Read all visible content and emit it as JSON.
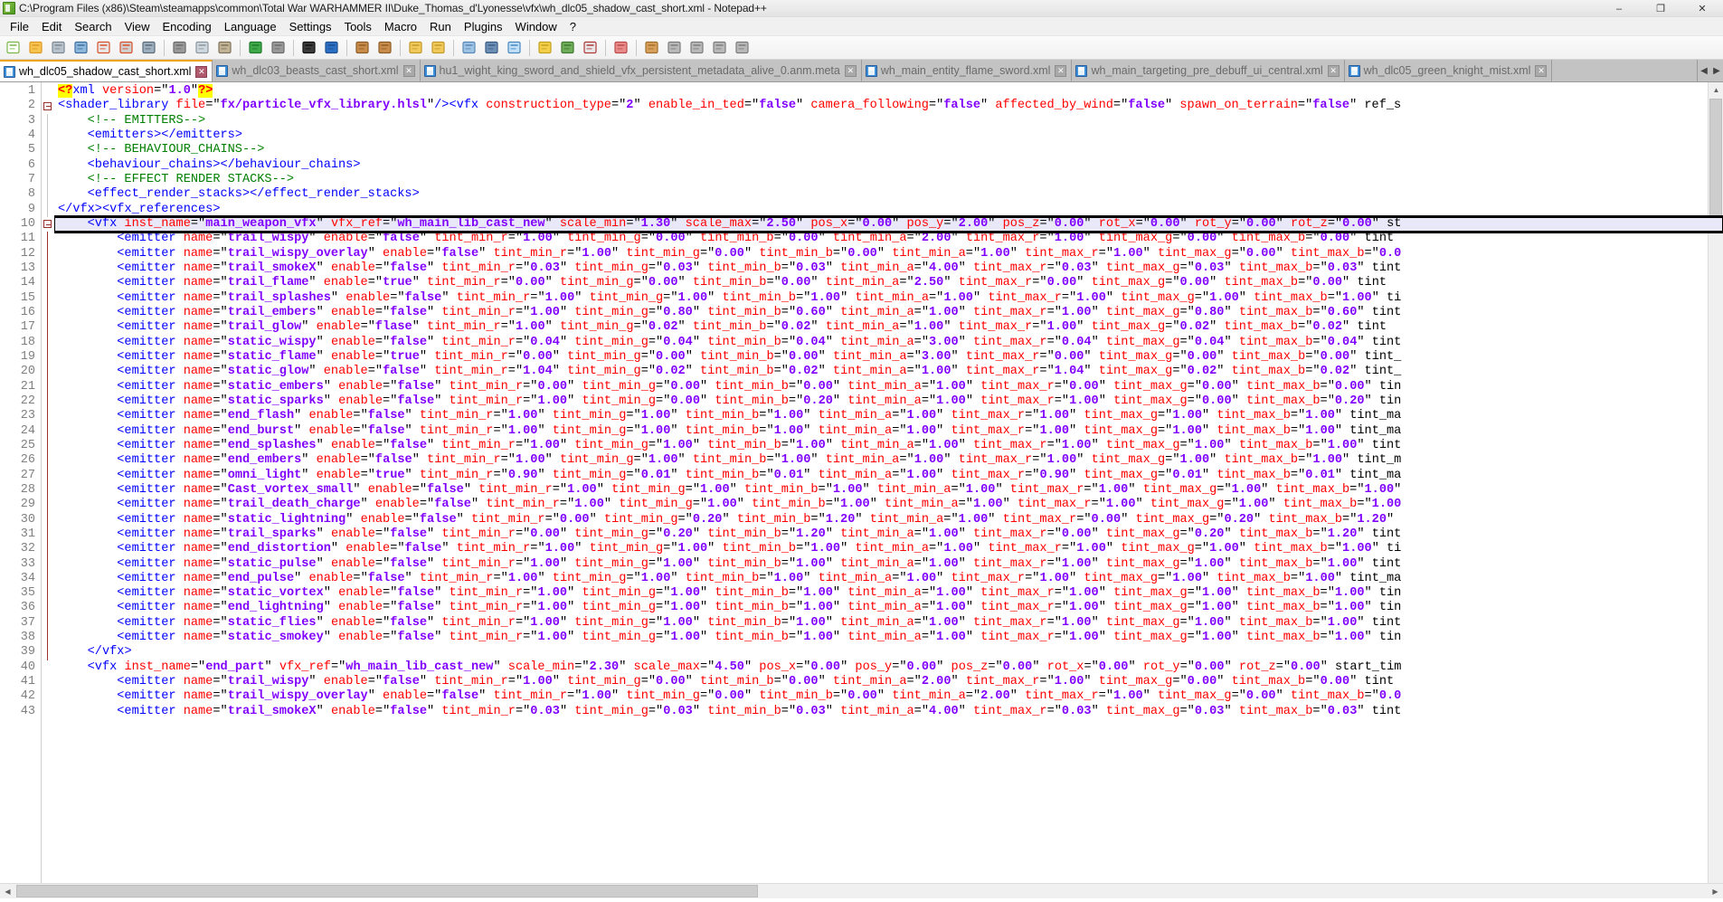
{
  "window": {
    "title": "C:\\Program Files (x86)\\Steam\\steamapps\\common\\Total War WARHAMMER II\\Duke_Thomas_d'Lyonesse\\vfx\\wh_dlc05_shadow_cast_short.xml - Notepad++",
    "icon": "notepadpp-icon",
    "minimize": "–",
    "maximize": "❐",
    "close": "✕"
  },
  "menu": {
    "items": [
      "File",
      "Edit",
      "Search",
      "View",
      "Encoding",
      "Language",
      "Settings",
      "Tools",
      "Macro",
      "Run",
      "Plugins",
      "Window",
      "?"
    ]
  },
  "toolbar": {
    "buttons": [
      "new-file-icon",
      "open-folder-icon",
      "save-icon",
      "save-all-icon",
      "close-file-icon",
      "close-all-icon",
      "print-icon",
      "cut-icon",
      "copy-icon",
      "paste-icon",
      "undo-icon",
      "redo-icon",
      "find-icon",
      "replace-icon",
      "zoom-in-icon",
      "zoom-out-icon",
      "sync-vertical-icon",
      "sync-horizontal-icon",
      "word-wrap-icon",
      "all-chars-icon",
      "indent-guide-icon",
      "ui-userdefined-icon",
      "doc-map-icon",
      "function-list-icon",
      "folder-workspace-icon",
      "macro-record-icon",
      "macro-stop-icon",
      "macro-play-icon",
      "macro-playmulti-icon",
      "macro-save-icon"
    ]
  },
  "tabs": [
    {
      "label": "wh_dlc05_shadow_cast_short.xml",
      "active": true,
      "close": "✕"
    },
    {
      "label": "wh_dlc03_beasts_cast_short.xml",
      "active": false,
      "close": "✕"
    },
    {
      "label": "hu1_wight_king_sword_and_shield_vfx_persistent_metadata_alive_0.anm.meta",
      "active": false,
      "close": "✕"
    },
    {
      "label": "wh_main_entity_flame_sword.xml",
      "active": false,
      "close": "✕"
    },
    {
      "label": "wh_main_targeting_pre_debuff_ui_central.xml",
      "active": false,
      "close": "✕"
    },
    {
      "label": "wh_dlc05_green_knight_mist.xml",
      "active": false,
      "close": "✕"
    }
  ],
  "tab_nav": {
    "left": "◀",
    "right": "▶"
  },
  "editor": {
    "first_line": 1,
    "highlighted_line": 10,
    "line_numbers": [
      1,
      2,
      3,
      4,
      5,
      6,
      7,
      8,
      9,
      10,
      11,
      12,
      13,
      14,
      15,
      16,
      17,
      18,
      19,
      20,
      21,
      22,
      23,
      24,
      25,
      26,
      27,
      28,
      29,
      30,
      31,
      32,
      33,
      34,
      35,
      36,
      37,
      38,
      39,
      40,
      41,
      42,
      43
    ],
    "lines": [
      {
        "n": 1,
        "indent": 0,
        "type": "pi",
        "text": "<?xml version=\"1.0\"?>"
      },
      {
        "n": 2,
        "indent": 0,
        "type": "code",
        "text": "<shader_library file=\"fx/particle_vfx_library.hlsl\"/><vfx construction_type=\"2\" enable_in_ted=\"false\" camera_following=\"false\" affected_by_wind=\"false\" spawn_on_terrain=\"false\" ref_s"
      },
      {
        "n": 3,
        "indent": 2,
        "type": "comment",
        "text": "<!-- EMITTERS-->"
      },
      {
        "n": 4,
        "indent": 2,
        "type": "code",
        "text": "<emitters></emitters>"
      },
      {
        "n": 5,
        "indent": 2,
        "type": "comment",
        "text": "<!-- BEHAVIOUR_CHAINS-->"
      },
      {
        "n": 6,
        "indent": 2,
        "type": "code",
        "text": "<behaviour_chains></behaviour_chains>"
      },
      {
        "n": 7,
        "indent": 2,
        "type": "comment",
        "text": "<!-- EFFECT RENDER STACKS-->"
      },
      {
        "n": 8,
        "indent": 2,
        "type": "code",
        "text": "<effect_render_stacks></effect_render_stacks>"
      },
      {
        "n": 9,
        "indent": 0,
        "type": "code",
        "text": "</vfx><vfx_references>"
      },
      {
        "n": 10,
        "indent": 2,
        "type": "code",
        "text": "<vfx inst_name=\"main_weapon_vfx\" vfx_ref=\"wh_main_lib_cast_new\" scale_min=\"1.30\" scale_max=\"2.50\" pos_x=\"0.00\" pos_y=\"2.00\" pos_z=\"0.00\" rot_x=\"0.00\" rot_y=\"0.00\" rot_z=\"0.00\" st"
      },
      {
        "n": 11,
        "indent": 4,
        "type": "code",
        "text": "<emitter name=\"trail_wispy\" enable=\"false\" tint_min_r=\"1.00\" tint_min_g=\"0.00\" tint_min_b=\"0.00\" tint_min_a=\"2.00\" tint_max_r=\"1.00\" tint_max_g=\"0.00\" tint_max_b=\"0.00\" tint"
      },
      {
        "n": 12,
        "indent": 4,
        "type": "code",
        "text": "<emitter name=\"trail_wispy_overlay\" enable=\"false\" tint_min_r=\"1.00\" tint_min_g=\"0.00\" tint_min_b=\"0.00\" tint_min_a=\"1.00\" tint_max_r=\"1.00\" tint_max_g=\"0.00\" tint_max_b=\"0.0"
      },
      {
        "n": 13,
        "indent": 4,
        "type": "code",
        "text": "<emitter name=\"trail_smokeX\" enable=\"false\" tint_min_r=\"0.03\" tint_min_g=\"0.03\" tint_min_b=\"0.03\" tint_min_a=\"4.00\" tint_max_r=\"0.03\" tint_max_g=\"0.03\" tint_max_b=\"0.03\" tint"
      },
      {
        "n": 14,
        "indent": 4,
        "type": "code",
        "text": "<emitter name=\"trail_flame\" enable=\"true\" tint_min_r=\"0.00\" tint_min_g=\"0.00\" tint_min_b=\"0.00\" tint_min_a=\"2.50\" tint_max_r=\"0.00\" tint_max_g=\"0.00\" tint_max_b=\"0.00\" tint"
      },
      {
        "n": 15,
        "indent": 4,
        "type": "code",
        "text": "<emitter name=\"trail_splashes\" enable=\"false\" tint_min_r=\"1.00\" tint_min_g=\"1.00\" tint_min_b=\"1.00\" tint_min_a=\"1.00\" tint_max_r=\"1.00\" tint_max_g=\"1.00\" tint_max_b=\"1.00\" ti"
      },
      {
        "n": 16,
        "indent": 4,
        "type": "code",
        "text": "<emitter name=\"trail_embers\" enable=\"false\" tint_min_r=\"1.00\" tint_min_g=\"0.80\" tint_min_b=\"0.60\" tint_min_a=\"1.00\" tint_max_r=\"1.00\" tint_max_g=\"0.80\" tint_max_b=\"0.60\" tint"
      },
      {
        "n": 17,
        "indent": 4,
        "type": "code",
        "text": "<emitter name=\"trail_glow\" enable=\"flase\" tint_min_r=\"1.00\" tint_min_g=\"0.02\" tint_min_b=\"0.02\" tint_min_a=\"1.00\" tint_max_r=\"1.00\" tint_max_g=\"0.02\" tint_max_b=\"0.02\" tint"
      },
      {
        "n": 18,
        "indent": 4,
        "type": "code",
        "text": "<emitter name=\"static_wispy\" enable=\"false\" tint_min_r=\"0.04\" tint_min_g=\"0.04\" tint_min_b=\"0.04\" tint_min_a=\"3.00\" tint_max_r=\"0.04\" tint_max_g=\"0.04\" tint_max_b=\"0.04\" tint"
      },
      {
        "n": 19,
        "indent": 4,
        "type": "code",
        "text": "<emitter name=\"static_flame\" enable=\"true\" tint_min_r=\"0.00\" tint_min_g=\"0.00\" tint_min_b=\"0.00\" tint_min_a=\"3.00\" tint_max_r=\"0.00\" tint_max_g=\"0.00\" tint_max_b=\"0.00\" tint_"
      },
      {
        "n": 20,
        "indent": 4,
        "type": "code",
        "text": "<emitter name=\"static_glow\" enable=\"false\" tint_min_r=\"1.04\" tint_min_g=\"0.02\" tint_min_b=\"0.02\" tint_min_a=\"1.00\" tint_max_r=\"1.04\" tint_max_g=\"0.02\" tint_max_b=\"0.02\" tint_"
      },
      {
        "n": 21,
        "indent": 4,
        "type": "code",
        "text": "<emitter name=\"static_embers\" enable=\"false\" tint_min_r=\"0.00\" tint_min_g=\"0.00\" tint_min_b=\"0.00\" tint_min_a=\"1.00\" tint_max_r=\"0.00\" tint_max_g=\"0.00\" tint_max_b=\"0.00\" tin"
      },
      {
        "n": 22,
        "indent": 4,
        "type": "code",
        "text": "<emitter name=\"static_sparks\" enable=\"false\" tint_min_r=\"1.00\" tint_min_g=\"0.00\" tint_min_b=\"0.20\" tint_min_a=\"1.00\" tint_max_r=\"1.00\" tint_max_g=\"0.00\" tint_max_b=\"0.20\" tin"
      },
      {
        "n": 23,
        "indent": 4,
        "type": "code",
        "text": "<emitter name=\"end_flash\" enable=\"false\" tint_min_r=\"1.00\" tint_min_g=\"1.00\" tint_min_b=\"1.00\" tint_min_a=\"1.00\" tint_max_r=\"1.00\" tint_max_g=\"1.00\" tint_max_b=\"1.00\" tint_ma"
      },
      {
        "n": 24,
        "indent": 4,
        "type": "code",
        "text": "<emitter name=\"end_burst\" enable=\"false\" tint_min_r=\"1.00\" tint_min_g=\"1.00\" tint_min_b=\"1.00\" tint_min_a=\"1.00\" tint_max_r=\"1.00\" tint_max_g=\"1.00\" tint_max_b=\"1.00\" tint_ma"
      },
      {
        "n": 25,
        "indent": 4,
        "type": "code",
        "text": "<emitter name=\"end_splashes\" enable=\"false\" tint_min_r=\"1.00\" tint_min_g=\"1.00\" tint_min_b=\"1.00\" tint_min_a=\"1.00\" tint_max_r=\"1.00\" tint_max_g=\"1.00\" tint_max_b=\"1.00\" tint"
      },
      {
        "n": 26,
        "indent": 4,
        "type": "code",
        "text": "<emitter name=\"end_embers\" enable=\"false\" tint_min_r=\"1.00\" tint_min_g=\"1.00\" tint_min_b=\"1.00\" tint_min_a=\"1.00\" tint_max_r=\"1.00\" tint_max_g=\"1.00\" tint_max_b=\"1.00\" tint_m"
      },
      {
        "n": 27,
        "indent": 4,
        "type": "code",
        "text": "<emitter name=\"omni_light\" enable=\"true\" tint_min_r=\"0.90\" tint_min_g=\"0.01\" tint_min_b=\"0.01\" tint_min_a=\"1.00\" tint_max_r=\"0.90\" tint_max_g=\"0.01\" tint_max_b=\"0.01\" tint_ma"
      },
      {
        "n": 28,
        "indent": 4,
        "type": "code",
        "text": "<emitter name=\"Cast_vortex_small\" enable=\"false\" tint_min_r=\"1.00\" tint_min_g=\"1.00\" tint_min_b=\"1.00\" tint_min_a=\"1.00\" tint_max_r=\"1.00\" tint_max_g=\"1.00\" tint_max_b=\"1.00\""
      },
      {
        "n": 29,
        "indent": 4,
        "type": "code",
        "text": "<emitter name=\"trail_death_charge\" enable=\"false\" tint_min_r=\"1.00\" tint_min_g=\"1.00\" tint_min_b=\"1.00\" tint_min_a=\"1.00\" tint_max_r=\"1.00\" tint_max_g=\"1.00\" tint_max_b=\"1.00"
      },
      {
        "n": 30,
        "indent": 4,
        "type": "code",
        "text": "<emitter name=\"static_lightning\" enable=\"false\" tint_min_r=\"0.00\" tint_min_g=\"0.20\" tint_min_b=\"1.20\" tint_min_a=\"1.00\" tint_max_r=\"0.00\" tint_max_g=\"0.20\" tint_max_b=\"1.20\""
      },
      {
        "n": 31,
        "indent": 4,
        "type": "code",
        "text": "<emitter name=\"trail_sparks\" enable=\"false\" tint_min_r=\"0.00\" tint_min_g=\"0.20\" tint_min_b=\"1.20\" tint_min_a=\"1.00\" tint_max_r=\"0.00\" tint_max_g=\"0.20\" tint_max_b=\"1.20\" tint"
      },
      {
        "n": 32,
        "indent": 4,
        "type": "code",
        "text": "<emitter name=\"end_distortion\" enable=\"false\" tint_min_r=\"1.00\" tint_min_g=\"1.00\" tint_min_b=\"1.00\" tint_min_a=\"1.00\" tint_max_r=\"1.00\" tint_max_g=\"1.00\" tint_max_b=\"1.00\" ti"
      },
      {
        "n": 33,
        "indent": 4,
        "type": "code",
        "text": "<emitter name=\"static_pulse\" enable=\"false\" tint_min_r=\"1.00\" tint_min_g=\"1.00\" tint_min_b=\"1.00\" tint_min_a=\"1.00\" tint_max_r=\"1.00\" tint_max_g=\"1.00\" tint_max_b=\"1.00\" tint"
      },
      {
        "n": 34,
        "indent": 4,
        "type": "code",
        "text": "<emitter name=\"end_pulse\" enable=\"false\" tint_min_r=\"1.00\" tint_min_g=\"1.00\" tint_min_b=\"1.00\" tint_min_a=\"1.00\" tint_max_r=\"1.00\" tint_max_g=\"1.00\" tint_max_b=\"1.00\" tint_ma"
      },
      {
        "n": 35,
        "indent": 4,
        "type": "code",
        "text": "<emitter name=\"static_vortex\" enable=\"false\" tint_min_r=\"1.00\" tint_min_g=\"1.00\" tint_min_b=\"1.00\" tint_min_a=\"1.00\" tint_max_r=\"1.00\" tint_max_g=\"1.00\" tint_max_b=\"1.00\" tin"
      },
      {
        "n": 36,
        "indent": 4,
        "type": "code",
        "text": "<emitter name=\"end_lightning\" enable=\"false\" tint_min_r=\"1.00\" tint_min_g=\"1.00\" tint_min_b=\"1.00\" tint_min_a=\"1.00\" tint_max_r=\"1.00\" tint_max_g=\"1.00\" tint_max_b=\"1.00\" tin"
      },
      {
        "n": 37,
        "indent": 4,
        "type": "code",
        "text": "<emitter name=\"static_flies\" enable=\"false\" tint_min_r=\"1.00\" tint_min_g=\"1.00\" tint_min_b=\"1.00\" tint_min_a=\"1.00\" tint_max_r=\"1.00\" tint_max_g=\"1.00\" tint_max_b=\"1.00\" tint"
      },
      {
        "n": 38,
        "indent": 4,
        "type": "code",
        "text": "<emitter name=\"static_smokey\" enable=\"false\" tint_min_r=\"1.00\" tint_min_g=\"1.00\" tint_min_b=\"1.00\" tint_min_a=\"1.00\" tint_max_r=\"1.00\" tint_max_g=\"1.00\" tint_max_b=\"1.00\" tin"
      },
      {
        "n": 39,
        "indent": 2,
        "type": "code",
        "text": "</vfx>"
      },
      {
        "n": 40,
        "indent": 2,
        "type": "code",
        "text": "<vfx inst_name=\"end_part\" vfx_ref=\"wh_main_lib_cast_new\" scale_min=\"2.30\" scale_max=\"4.50\" pos_x=\"0.00\" pos_y=\"0.00\" pos_z=\"0.00\" rot_x=\"0.00\" rot_y=\"0.00\" rot_z=\"0.00\" start_tim"
      },
      {
        "n": 41,
        "indent": 4,
        "type": "code",
        "text": "<emitter name=\"trail_wispy\" enable=\"false\" tint_min_r=\"1.00\" tint_min_g=\"0.00\" tint_min_b=\"0.00\" tint_min_a=\"2.00\" tint_max_r=\"1.00\" tint_max_g=\"0.00\" tint_max_b=\"0.00\" tint"
      },
      {
        "n": 42,
        "indent": 4,
        "type": "code",
        "text": "<emitter name=\"trail_wispy_overlay\" enable=\"false\" tint_min_r=\"1.00\" tint_min_g=\"0.00\" tint_min_b=\"0.00\" tint_min_a=\"2.00\" tint_max_r=\"1.00\" tint_max_g=\"0.00\" tint_max_b=\"0.0"
      },
      {
        "n": 43,
        "indent": 4,
        "type": "code",
        "text": "<emitter name=\"trail_smokeX\" enable=\"false\" tint_min_r=\"0.03\" tint_min_g=\"0.03\" tint_min_b=\"0.03\" tint_min_a=\"4.00\" tint_max_r=\"0.03\" tint_max_g=\"0.03\" tint_max_b=\"0.03\" tint"
      }
    ]
  },
  "scrollbars": {
    "vertical": {
      "up": "▲",
      "down": "▼"
    },
    "horizontal": {
      "left": "◀",
      "right": "▶"
    }
  },
  "colors": {
    "tag": "#0000ff",
    "attribute": "#ff0000",
    "value": "#8000ff",
    "comment": "#008000",
    "pi_highlight": "#ffff00",
    "active_tab_accent": "#f0a30a",
    "tabbar_bg": "#c3c3c3",
    "highlight_line_bg": "#e8e8f8"
  }
}
